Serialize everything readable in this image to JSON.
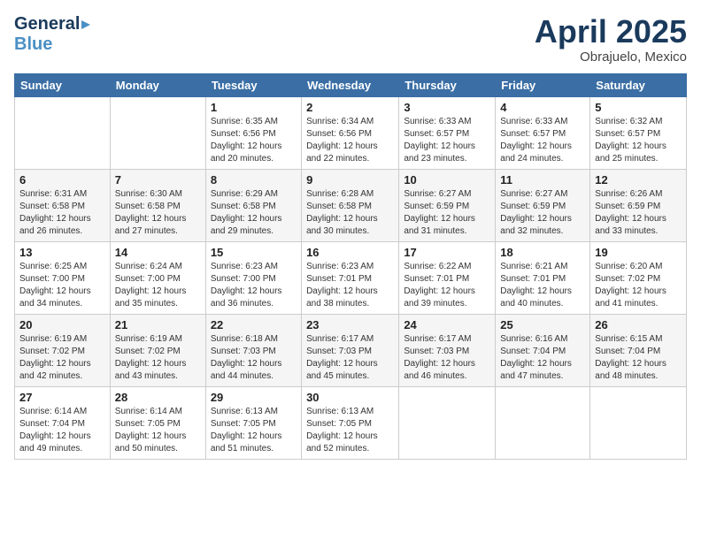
{
  "header": {
    "logo_general": "General",
    "logo_blue": "Blue",
    "title": "April 2025",
    "subtitle": "Obrajuelo, Mexico"
  },
  "days_of_week": [
    "Sunday",
    "Monday",
    "Tuesday",
    "Wednesday",
    "Thursday",
    "Friday",
    "Saturday"
  ],
  "weeks": [
    [
      {
        "day": "",
        "detail": ""
      },
      {
        "day": "",
        "detail": ""
      },
      {
        "day": "1",
        "detail": "Sunrise: 6:35 AM\nSunset: 6:56 PM\nDaylight: 12 hours and 20 minutes."
      },
      {
        "day": "2",
        "detail": "Sunrise: 6:34 AM\nSunset: 6:56 PM\nDaylight: 12 hours and 22 minutes."
      },
      {
        "day": "3",
        "detail": "Sunrise: 6:33 AM\nSunset: 6:57 PM\nDaylight: 12 hours and 23 minutes."
      },
      {
        "day": "4",
        "detail": "Sunrise: 6:33 AM\nSunset: 6:57 PM\nDaylight: 12 hours and 24 minutes."
      },
      {
        "day": "5",
        "detail": "Sunrise: 6:32 AM\nSunset: 6:57 PM\nDaylight: 12 hours and 25 minutes."
      }
    ],
    [
      {
        "day": "6",
        "detail": "Sunrise: 6:31 AM\nSunset: 6:58 PM\nDaylight: 12 hours and 26 minutes."
      },
      {
        "day": "7",
        "detail": "Sunrise: 6:30 AM\nSunset: 6:58 PM\nDaylight: 12 hours and 27 minutes."
      },
      {
        "day": "8",
        "detail": "Sunrise: 6:29 AM\nSunset: 6:58 PM\nDaylight: 12 hours and 29 minutes."
      },
      {
        "day": "9",
        "detail": "Sunrise: 6:28 AM\nSunset: 6:58 PM\nDaylight: 12 hours and 30 minutes."
      },
      {
        "day": "10",
        "detail": "Sunrise: 6:27 AM\nSunset: 6:59 PM\nDaylight: 12 hours and 31 minutes."
      },
      {
        "day": "11",
        "detail": "Sunrise: 6:27 AM\nSunset: 6:59 PM\nDaylight: 12 hours and 32 minutes."
      },
      {
        "day": "12",
        "detail": "Sunrise: 6:26 AM\nSunset: 6:59 PM\nDaylight: 12 hours and 33 minutes."
      }
    ],
    [
      {
        "day": "13",
        "detail": "Sunrise: 6:25 AM\nSunset: 7:00 PM\nDaylight: 12 hours and 34 minutes."
      },
      {
        "day": "14",
        "detail": "Sunrise: 6:24 AM\nSunset: 7:00 PM\nDaylight: 12 hours and 35 minutes."
      },
      {
        "day": "15",
        "detail": "Sunrise: 6:23 AM\nSunset: 7:00 PM\nDaylight: 12 hours and 36 minutes."
      },
      {
        "day": "16",
        "detail": "Sunrise: 6:23 AM\nSunset: 7:01 PM\nDaylight: 12 hours and 38 minutes."
      },
      {
        "day": "17",
        "detail": "Sunrise: 6:22 AM\nSunset: 7:01 PM\nDaylight: 12 hours and 39 minutes."
      },
      {
        "day": "18",
        "detail": "Sunrise: 6:21 AM\nSunset: 7:01 PM\nDaylight: 12 hours and 40 minutes."
      },
      {
        "day": "19",
        "detail": "Sunrise: 6:20 AM\nSunset: 7:02 PM\nDaylight: 12 hours and 41 minutes."
      }
    ],
    [
      {
        "day": "20",
        "detail": "Sunrise: 6:19 AM\nSunset: 7:02 PM\nDaylight: 12 hours and 42 minutes."
      },
      {
        "day": "21",
        "detail": "Sunrise: 6:19 AM\nSunset: 7:02 PM\nDaylight: 12 hours and 43 minutes."
      },
      {
        "day": "22",
        "detail": "Sunrise: 6:18 AM\nSunset: 7:03 PM\nDaylight: 12 hours and 44 minutes."
      },
      {
        "day": "23",
        "detail": "Sunrise: 6:17 AM\nSunset: 7:03 PM\nDaylight: 12 hours and 45 minutes."
      },
      {
        "day": "24",
        "detail": "Sunrise: 6:17 AM\nSunset: 7:03 PM\nDaylight: 12 hours and 46 minutes."
      },
      {
        "day": "25",
        "detail": "Sunrise: 6:16 AM\nSunset: 7:04 PM\nDaylight: 12 hours and 47 minutes."
      },
      {
        "day": "26",
        "detail": "Sunrise: 6:15 AM\nSunset: 7:04 PM\nDaylight: 12 hours and 48 minutes."
      }
    ],
    [
      {
        "day": "27",
        "detail": "Sunrise: 6:14 AM\nSunset: 7:04 PM\nDaylight: 12 hours and 49 minutes."
      },
      {
        "day": "28",
        "detail": "Sunrise: 6:14 AM\nSunset: 7:05 PM\nDaylight: 12 hours and 50 minutes."
      },
      {
        "day": "29",
        "detail": "Sunrise: 6:13 AM\nSunset: 7:05 PM\nDaylight: 12 hours and 51 minutes."
      },
      {
        "day": "30",
        "detail": "Sunrise: 6:13 AM\nSunset: 7:05 PM\nDaylight: 12 hours and 52 minutes."
      },
      {
        "day": "",
        "detail": ""
      },
      {
        "day": "",
        "detail": ""
      },
      {
        "day": "",
        "detail": ""
      }
    ]
  ]
}
